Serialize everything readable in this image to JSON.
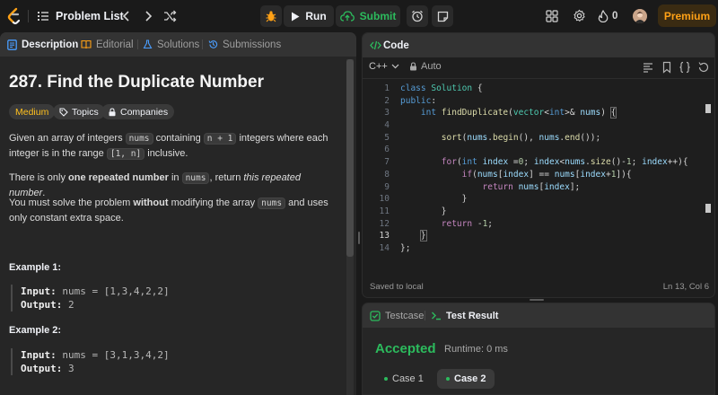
{
  "topbar": {
    "problem_list": "Problem List",
    "run": "Run",
    "submit": "Submit",
    "streak_count": "0",
    "premium": "Premium",
    "accent": "#ffa116",
    "submit_color": "#2cbb5d"
  },
  "left_tabs": {
    "description": "Description",
    "editorial": "Editorial",
    "solutions": "Solutions",
    "submissions": "Submissions"
  },
  "problem": {
    "title": "287. Find the Duplicate Number",
    "difficulty": "Medium",
    "topics": "Topics",
    "companies": "Companies",
    "p1_a": "Given an array of integers ",
    "p1_code1": "nums",
    "p1_b": " containing ",
    "p1_code2": "n + 1",
    "p1_c": " integers where each integer is in the range ",
    "p1_code3": "[1, n]",
    "p1_d": " inclusive.",
    "p2_a": "There is only ",
    "p2_bold": "one repeated number",
    "p2_b": " in ",
    "p2_code": "nums",
    "p2_c": ", return ",
    "p2_italic": "this repeated number",
    "p2_d": ".",
    "p3_a": "You must solve the problem ",
    "p3_bold": "without",
    "p3_b": " modifying the array ",
    "p3_code": "nums",
    "p3_c": " and uses only constant extra space.",
    "examples": [
      {
        "title": "Example 1:",
        "input_label": "Input:",
        "input": "nums = [1,3,4,2,2]",
        "output_label": "Output:",
        "output": "2"
      },
      {
        "title": "Example 2:",
        "input_label": "Input:",
        "input": "nums = [3,1,3,4,2]",
        "output_label": "Output:",
        "output": "3"
      }
    ]
  },
  "code": {
    "header": "Code",
    "language": "C++",
    "mode": "Auto",
    "line_numbers": [
      "1",
      "2",
      "3",
      "4",
      "5",
      "6",
      "7",
      "8",
      "9",
      "10",
      "11",
      "12",
      "13",
      "14"
    ],
    "saved": "Saved to local",
    "cursor": "Ln 13, Col 6"
  },
  "test": {
    "testcase_tab": "Testcase",
    "result_tab": "Test Result",
    "status": "Accepted",
    "runtime": "Runtime: 0 ms",
    "cases": [
      "Case 1",
      "Case 2"
    ]
  }
}
